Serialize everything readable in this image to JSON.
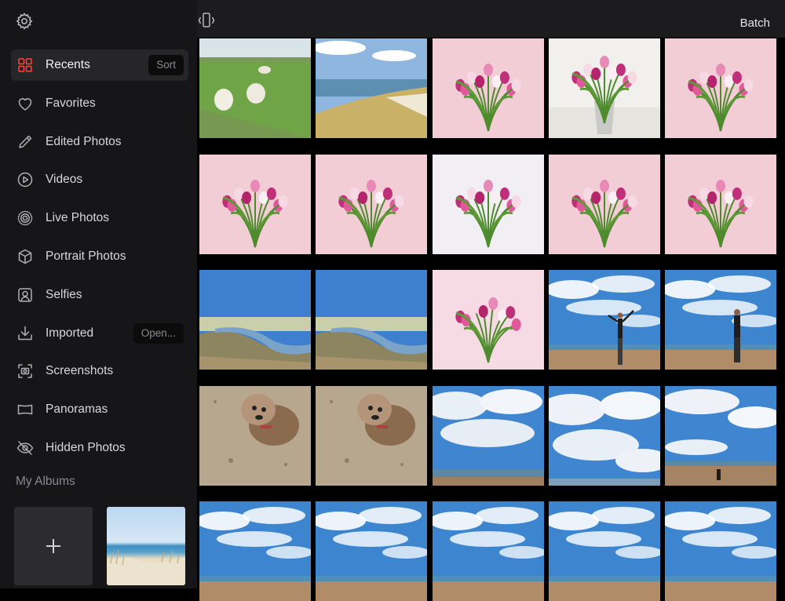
{
  "toolbar": {
    "batch_label": "Batch",
    "settings_icon": "gear-icon",
    "view_icon": "vibrate-phone-icon"
  },
  "sidebar": {
    "items": [
      {
        "label": "Recents",
        "icon": "grid-icon",
        "pill": "Sort",
        "active": true
      },
      {
        "label": "Favorites",
        "icon": "heart-icon"
      },
      {
        "label": "Edited Photos",
        "icon": "pencil-icon"
      },
      {
        "label": "Videos",
        "icon": "play-circle-icon"
      },
      {
        "label": "Live Photos",
        "icon": "live-photo-icon"
      },
      {
        "label": "Portrait Photos",
        "icon": "cube-icon"
      },
      {
        "label": "Selfies",
        "icon": "portrait-frame-icon"
      },
      {
        "label": "Imported",
        "icon": "download-icon",
        "pill": "Open..."
      },
      {
        "label": "Screenshots",
        "icon": "screenshot-icon"
      },
      {
        "label": "Panoramas",
        "icon": "panorama-icon"
      },
      {
        "label": "Hidden Photos",
        "icon": "eye-slash-icon"
      }
    ],
    "albums_title": "My Albums",
    "new_album_icon": "plus-icon"
  },
  "photos": [
    "lambs-field",
    "coast-meadow",
    "pink-tulips-bouquet",
    "tulips-in-vase",
    "pink-tulips-bouquet",
    "pink-tulips-bouquet",
    "pink-tulips-bouquet",
    "white-pink-tulips",
    "pink-tulips-bouquet",
    "pink-tulips-bouquet",
    "river-marsh",
    "river-marsh",
    "tulips-on-white",
    "beach-person-arms",
    "beach-person-walking",
    "dog-on-sand",
    "dog-on-sand",
    "cloudy-sky-sea",
    "cloudy-sky",
    "cloudy-sky-beach-figure",
    "blue-sky-beach",
    "blue-sky-beach",
    "blue-sky-beach",
    "blue-sky-beach",
    "blue-sky-beach"
  ],
  "colors": {
    "sidebar_bg": "#161618",
    "active_item_bg": "#262629",
    "accent": "#ff3b30"
  }
}
